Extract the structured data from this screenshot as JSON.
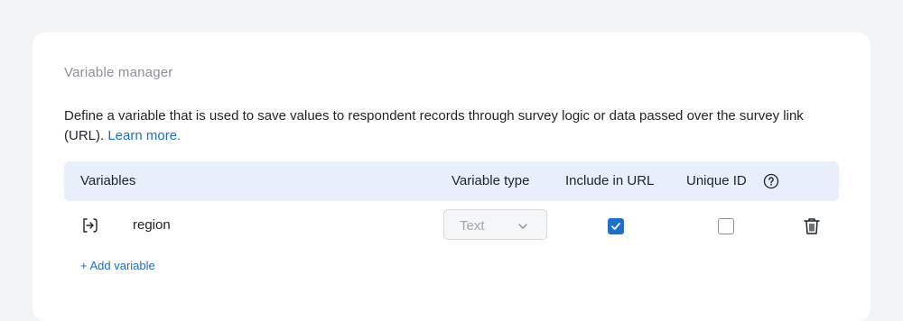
{
  "card": {
    "title": "Variable manager",
    "description": "Define a variable that is used to save values to respondent records through survey logic or data passed over the survey link (URL).",
    "learn_more": "Learn more."
  },
  "table": {
    "headers": {
      "variables": "Variables",
      "variable_type": "Variable type",
      "include_in_url": "Include in URL",
      "unique_id": "Unique ID"
    },
    "rows": [
      {
        "name": "region",
        "type": "Text",
        "include_in_url": true,
        "unique_id": false
      }
    ]
  },
  "add_variable_label": "+ Add variable",
  "colors": {
    "accent": "#1a6fd1",
    "header_bg": "#e7f0fa",
    "page_bg": "#f3f4f6"
  },
  "icons": {
    "variable": "input-arrow-icon",
    "help": "question-circle-icon",
    "chevron": "chevron-down-icon",
    "check": "checkmark-icon",
    "delete": "trash-icon"
  }
}
